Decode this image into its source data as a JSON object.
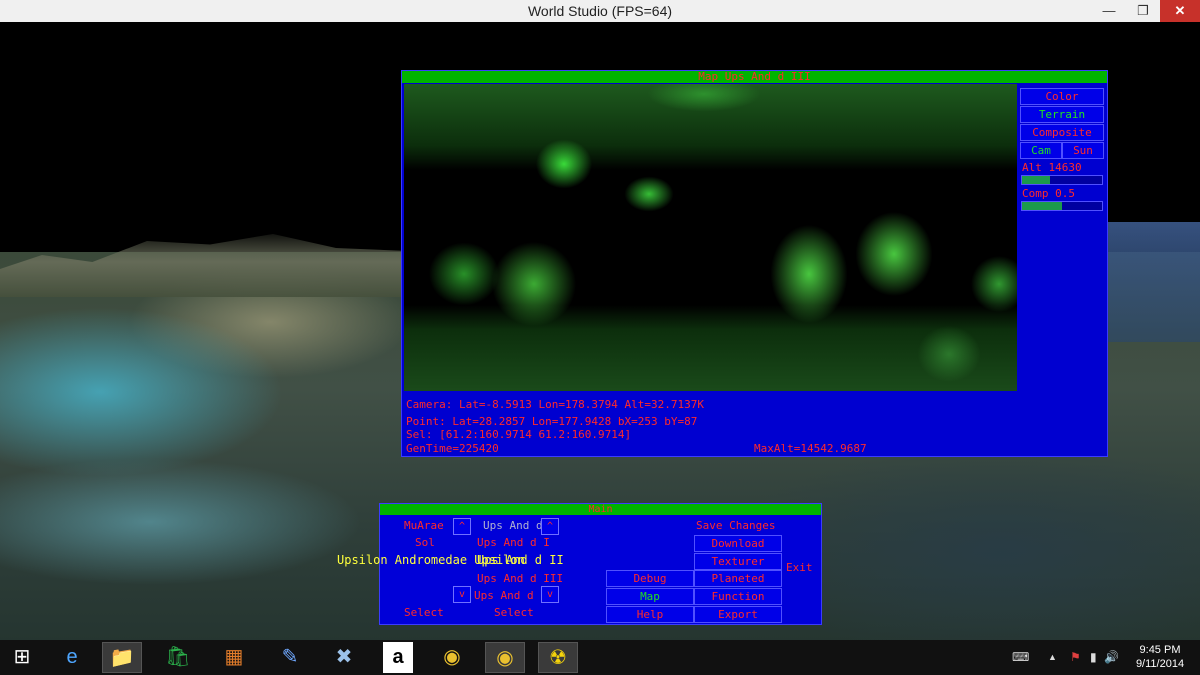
{
  "window": {
    "title": "World Studio (FPS=64)",
    "minimize": "—",
    "maximize": "❐",
    "close": "✕"
  },
  "map_window": {
    "title": "Map Ups And d III",
    "buttons": {
      "color": "Color",
      "terrain": "Terrain",
      "composite": "Composite",
      "cam": "Cam",
      "sun": "Sun"
    },
    "alt_slider": {
      "label": "Alt  14630",
      "fill_fraction": 0.35
    },
    "comp_slider": {
      "label": "Comp 0.5",
      "fill_fraction": 0.5
    },
    "info": {
      "camera": "Camera: Lat=-8.5913 Lon=178.3794 Alt=32.7137K",
      "point": "Point: Lat=28.2857 Lon=177.9428 bX=253 bY=87",
      "sel": "Sel: [61.2:160.9714 61.2:160.9714]",
      "gentime": "GenTime=225420",
      "maxalt": "MaxAlt=14542.9687"
    }
  },
  "main_window": {
    "title": "Main",
    "left_list": {
      "item1": "MuArae",
      "item2": "Sol",
      "select": "Select"
    },
    "mid_list": {
      "item1": "Ups And d",
      "item2": "Ups And d I",
      "item3": "Ups And d II",
      "item4": "Ups And d III",
      "item5": "Ups And d",
      "select": "Select"
    },
    "arrows": {
      "up": "^",
      "down": "v"
    },
    "highlight_label": "Upsilon Andromedae Upsilon",
    "buttons": {
      "debug": "Debug",
      "map": "Map",
      "help": "Help",
      "save_changes": "Save Changes",
      "download": "Download",
      "texturer": "Texturer",
      "planeted": "Planeted",
      "function": "Function",
      "export": "Export",
      "exit": "Exit"
    }
  },
  "taskbar": {
    "start_icon": "⊞",
    "icons": [
      "ie-icon",
      "file-explorer-icon",
      "store-icon",
      "app-icon",
      "app2-icon",
      "app3-icon",
      "amazon-icon",
      "chrome-icon",
      "chrome-active-icon",
      "radiation-icon"
    ],
    "icon_glyphs": [
      "e",
      "📁",
      "🛍",
      "▦",
      "✎",
      "✖",
      "a",
      "◉",
      "◉",
      "☢"
    ],
    "tray": {
      "keyboard": "⌨",
      "chevron": "▲",
      "flag": "⚑",
      "signal": "▮",
      "volume": "🔊"
    },
    "time": "9:45 PM",
    "date": "9/11/2014"
  }
}
